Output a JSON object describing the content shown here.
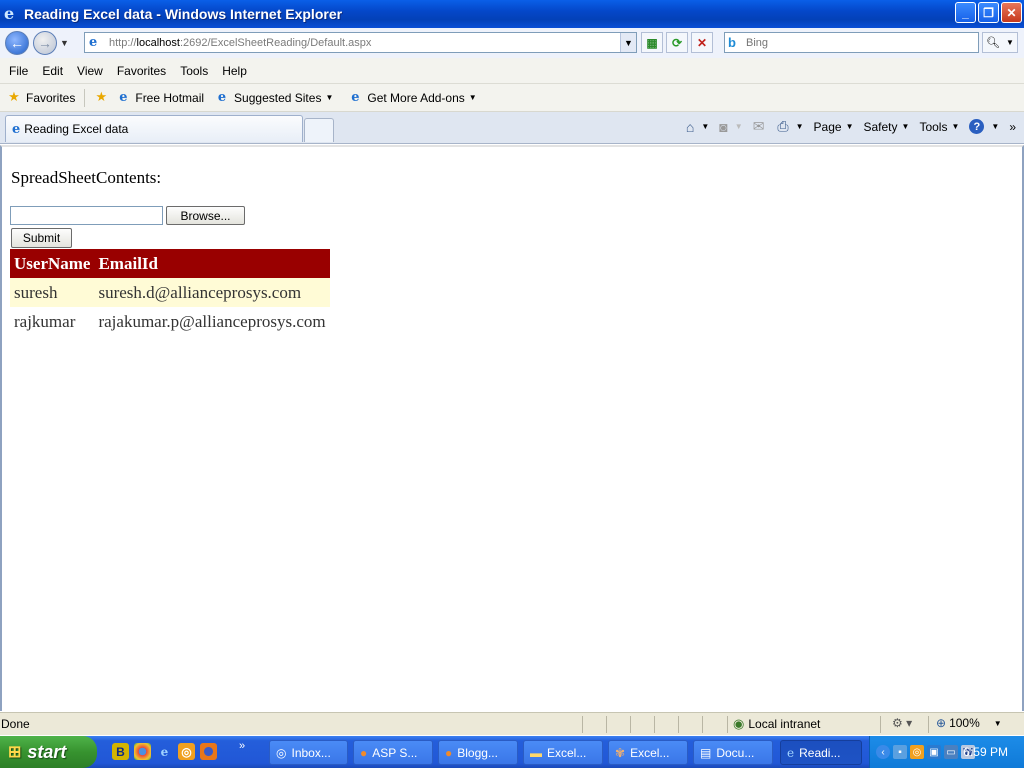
{
  "window": {
    "title": "Reading Excel data - Windows Internet Explorer"
  },
  "address": {
    "url_prefix": "http://",
    "url_host": "localhost",
    "url_rest": ":2692/ExcelSheetReading/Default.aspx",
    "search_placeholder": "Bing"
  },
  "menu": [
    "File",
    "Edit",
    "View",
    "Favorites",
    "Tools",
    "Help"
  ],
  "favorites": {
    "label": "Favorites",
    "links": [
      "Free Hotmail",
      "Suggested Sites",
      "Get More Add-ons"
    ]
  },
  "tab": {
    "label": "Reading Excel data"
  },
  "commands": {
    "page": "Page",
    "safety": "Safety",
    "tools": "Tools"
  },
  "page": {
    "heading": "SpreadSheetContents:",
    "browse_label": "Browse...",
    "submit_label": "Submit",
    "table": {
      "headers": [
        "UserName",
        "EmailId"
      ],
      "rows": [
        [
          "suresh",
          "suresh.d@allianceprosys.com"
        ],
        [
          "rajkumar",
          "rajakumar.p@allianceprosys.com"
        ]
      ]
    }
  },
  "status": {
    "text": "Done",
    "zone": "Local intranet",
    "zoom": "100%"
  },
  "taskbar": {
    "start": "start",
    "buttons": [
      "Inbox...",
      "ASP S...",
      "Blogg...",
      "Excel...",
      "Excel...",
      "Docu...",
      "Readi..."
    ],
    "clock": "6:59 PM"
  },
  "colors": {
    "header_bg": "#990000",
    "alt_row": "#fffbd6",
    "title_bar": "#0447c9"
  }
}
